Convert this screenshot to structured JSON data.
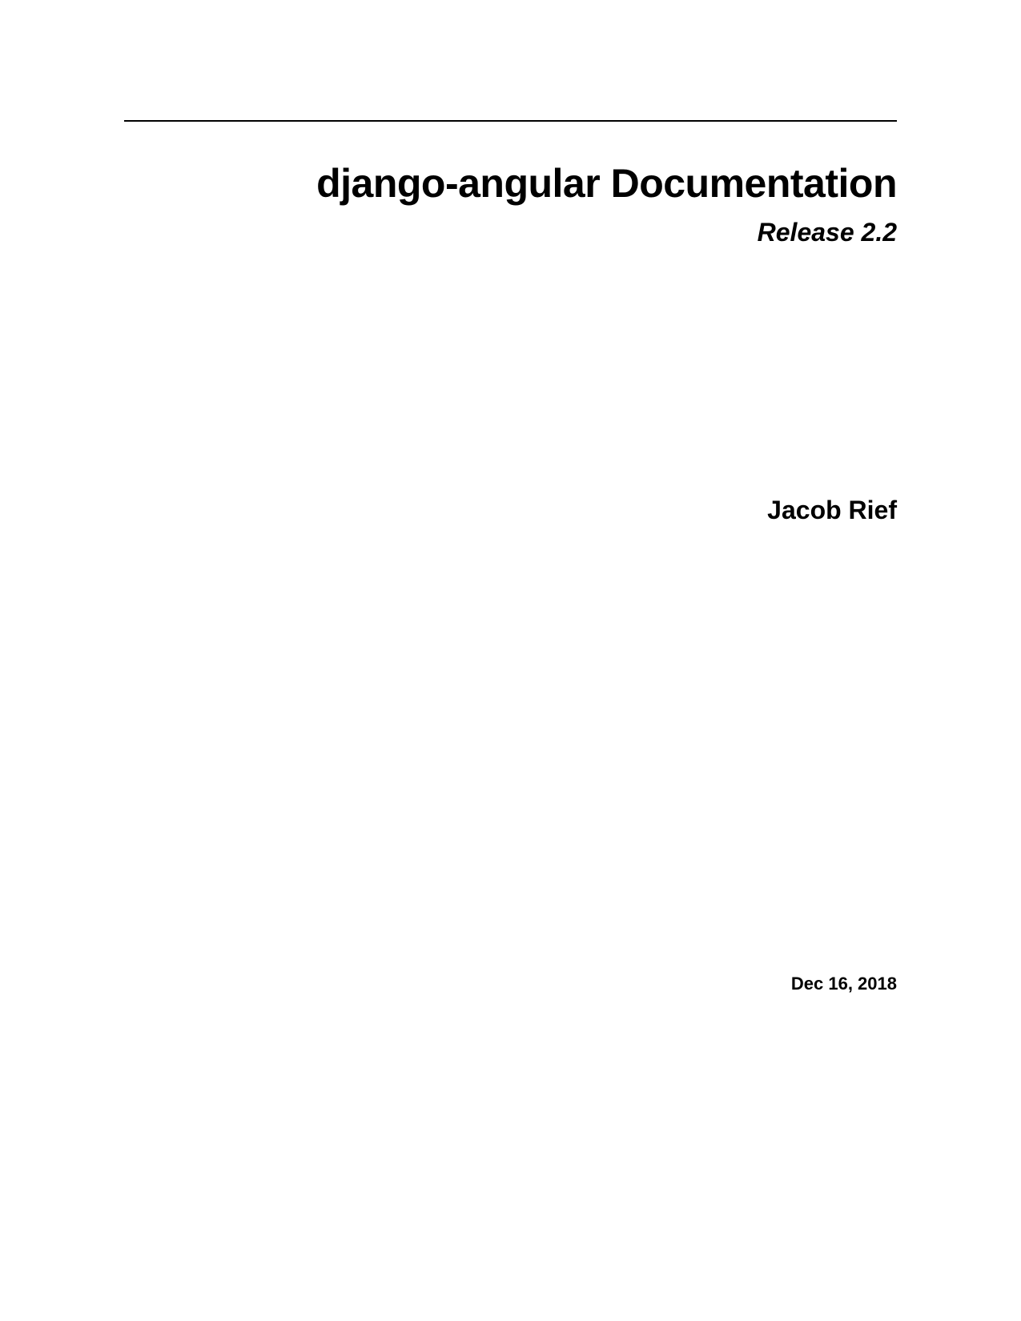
{
  "title": "django-angular Documentation",
  "release": "Release 2.2",
  "author": "Jacob Rief",
  "date": "Dec 16, 2018"
}
